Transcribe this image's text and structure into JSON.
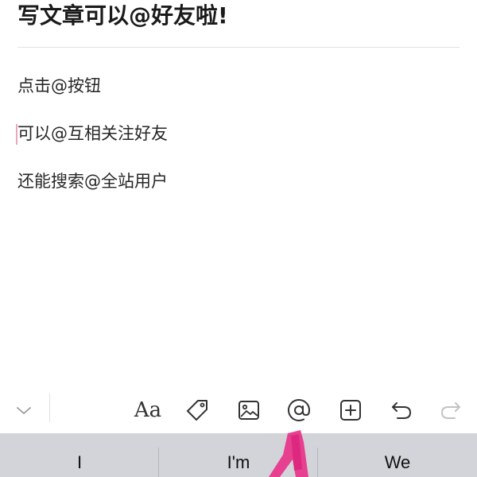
{
  "article": {
    "title": "写文章可以@好友啦!",
    "paragraphs": [
      "点击@按钮",
      "可以@互相关注好友",
      "还能搜索@全站用户"
    ]
  },
  "toolbar": {
    "icons": [
      "chevron-down-icon",
      "font-format-icon",
      "tag-icon",
      "image-icon",
      "at-mention-icon",
      "add-box-icon",
      "undo-icon",
      "redo-icon"
    ],
    "font_label": "Aa"
  },
  "keyboard": {
    "suggestions": [
      "I",
      "I'm",
      "We"
    ]
  },
  "colors": {
    "highlight_marker": "#e8338a",
    "caret": "#e8a8c0",
    "keyboard_bg": "#d2d4d9"
  }
}
